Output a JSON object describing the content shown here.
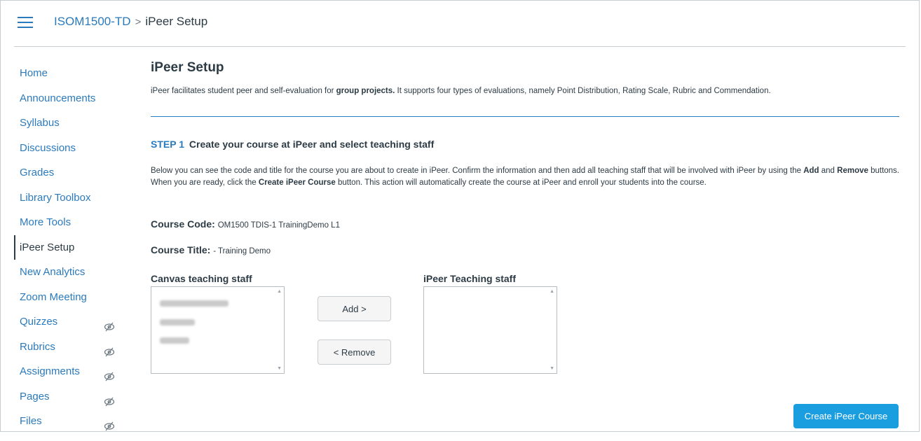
{
  "header": {
    "course_link": "ISOM1500-TD",
    "separator": ">",
    "current_page": "iPeer Setup"
  },
  "sidebar": {
    "items": [
      {
        "label": "Home",
        "hidden": false
      },
      {
        "label": "Announcements",
        "hidden": false
      },
      {
        "label": "Syllabus",
        "hidden": false
      },
      {
        "label": "Discussions",
        "hidden": false
      },
      {
        "label": "Grades",
        "hidden": false
      },
      {
        "label": "Library Toolbox",
        "hidden": false
      },
      {
        "label": "More Tools",
        "hidden": false
      },
      {
        "label": "iPeer Setup",
        "hidden": false,
        "active": true
      },
      {
        "label": "New Analytics",
        "hidden": false
      },
      {
        "label": "Zoom Meeting",
        "hidden": false
      },
      {
        "label": "Quizzes",
        "hidden": true
      },
      {
        "label": "Rubrics",
        "hidden": true
      },
      {
        "label": "Assignments",
        "hidden": true
      },
      {
        "label": "Pages",
        "hidden": true
      },
      {
        "label": "Files",
        "hidden": true
      }
    ]
  },
  "main": {
    "title": "iPeer Setup",
    "intro_1": "iPeer facilitates student peer and self-evaluation for ",
    "intro_bold": "group projects.",
    "intro_2": " It supports four types of evaluations, namely Point Distribution, Rating Scale, Rubric and Commendation.",
    "step_number": "STEP 1",
    "step_title": "Create your course at iPeer and select teaching staff",
    "desc_1": "Below you can see the code and title for the course you are about to create in iPeer. Confirm the information and then add all teaching staff that will be involved with iPeer by using the ",
    "desc_add": "Add",
    "desc_2": " and ",
    "desc_remove": "Remove",
    "desc_3": " buttons. When you are ready, click the ",
    "desc_create": "Create iPeer Course",
    "desc_4": " button. This action will automatically create the course at iPeer and enroll your students into the course.",
    "course_code_label": "Course Code:",
    "course_code_value": "OM1500 TDIS-1 TrainingDemo L1",
    "course_title_label": "Course Title:",
    "course_title_value": "- Training Demo",
    "canvas_staff_label": "Canvas teaching staff",
    "ipeer_staff_label": "iPeer Teaching staff",
    "add_button": "Add >",
    "remove_button": "< Remove",
    "create_button": "Create iPeer Course"
  },
  "colors": {
    "link": "#2b7abc",
    "primary_button": "#1a9ee0",
    "text": "#2d3b45"
  }
}
